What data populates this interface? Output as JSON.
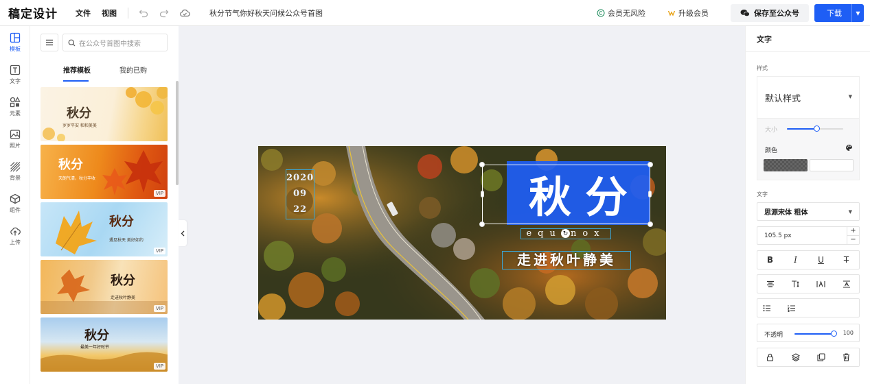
{
  "app": {
    "logo": "稿定设计"
  },
  "topbar": {
    "menu_file": "文件",
    "menu_view": "视图",
    "doc_title": "秋分节气你好秋天问候公众号首图",
    "member_risk": "会员无风险",
    "upgrade": "升级会员",
    "save_wechat": "保存至公众号",
    "download": "下载"
  },
  "rail": [
    {
      "label": "模板",
      "icon": "template-icon"
    },
    {
      "label": "文字",
      "icon": "text-icon"
    },
    {
      "label": "元素",
      "icon": "elements-icon"
    },
    {
      "label": "照片",
      "icon": "photo-icon"
    },
    {
      "label": "背景",
      "icon": "background-icon"
    },
    {
      "label": "组件",
      "icon": "component-icon"
    },
    {
      "label": "上传",
      "icon": "upload-icon"
    }
  ],
  "panel": {
    "search_placeholder": "在公众号首图中搜索",
    "tab_recommended": "推荐模板",
    "tab_purchased": "我的已购",
    "thumbs": [
      {
        "title": "秋分",
        "sub": "岁岁平安 和和美美",
        "vip": ""
      },
      {
        "title": "秋分",
        "sub": "天朗气清，秋分丰收",
        "vip": "VIP"
      },
      {
        "title": "秋分",
        "sub": "遇见秋天 美好如约",
        "vip": "VIP"
      },
      {
        "title": "秋分",
        "sub": "走进秋叶静美",
        "vip": "VIP"
      },
      {
        "title": "秋分",
        "sub": "最美一年好时节",
        "vip": "VIP"
      }
    ]
  },
  "canvas": {
    "date_year": "2020",
    "date_month": "09",
    "date_day": "22",
    "title": "秋分",
    "english": "equinox",
    "subtitle": "走进秋叶静美"
  },
  "props": {
    "panel_title": "文字",
    "section_style": "样式",
    "style_value": "默认样式",
    "size_label": "大小",
    "size_fraction": 0.53,
    "color_label": "颜色",
    "section_text": "文字",
    "font_family": "思源宋体 粗体",
    "font_size": "105.5 px",
    "opacity_label": "不透明",
    "opacity_value": "100",
    "opacity_fraction": 1.0
  }
}
